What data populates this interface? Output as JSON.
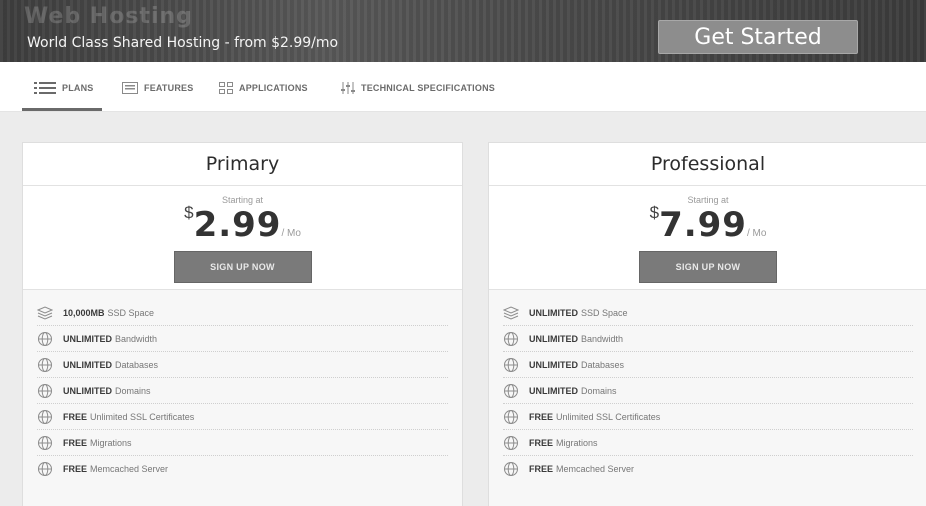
{
  "hero": {
    "title": "Web Hosting",
    "subtitle": "World Class Shared Hosting - from $2.99/mo",
    "cta_label": "Get Started"
  },
  "tabs": [
    {
      "label": "PLANS",
      "icon": "list-icon",
      "active": true
    },
    {
      "label": "FEATURES",
      "icon": "features-icon",
      "active": false
    },
    {
      "label": "APPLICATIONS",
      "icon": "grid-icon",
      "active": false
    },
    {
      "label": "TECHNICAL SPECIFICATIONS",
      "icon": "sliders-icon",
      "active": false
    }
  ],
  "plans": [
    {
      "name": "Primary",
      "starting_label": "Starting at",
      "currency": "$",
      "price": "2.99",
      "period": "/ Mo",
      "button_label": "SIGN UP NOW",
      "features": [
        {
          "strong": "10,000MB",
          "rest": "SSD Space",
          "icon": "storage-icon"
        },
        {
          "strong": "UNLIMITED",
          "rest": "Bandwidth",
          "icon": "globe-icon"
        },
        {
          "strong": "UNLIMITED",
          "rest": "Databases",
          "icon": "globe-icon"
        },
        {
          "strong": "UNLIMITED",
          "rest": "Domains",
          "icon": "globe-icon"
        },
        {
          "strong": "FREE",
          "rest": "Unlimited SSL Certificates",
          "icon": "globe-icon"
        },
        {
          "strong": "FREE",
          "rest": "Migrations",
          "icon": "globe-icon"
        },
        {
          "strong": "FREE",
          "rest": "Memcached Server",
          "icon": "globe-icon"
        }
      ]
    },
    {
      "name": "Professional",
      "starting_label": "Starting at",
      "currency": "$",
      "price": "7.99",
      "period": "/ Mo",
      "button_label": "SIGN UP NOW",
      "features": [
        {
          "strong": "UNLIMITED",
          "rest": "SSD Space",
          "icon": "storage-icon"
        },
        {
          "strong": "UNLIMITED",
          "rest": "Bandwidth",
          "icon": "globe-icon"
        },
        {
          "strong": "UNLIMITED",
          "rest": "Databases",
          "icon": "globe-icon"
        },
        {
          "strong": "UNLIMITED",
          "rest": "Domains",
          "icon": "globe-icon"
        },
        {
          "strong": "FREE",
          "rest": "Unlimited SSL Certificates",
          "icon": "globe-icon"
        },
        {
          "strong": "FREE",
          "rest": "Migrations",
          "icon": "globe-icon"
        },
        {
          "strong": "FREE",
          "rest": "Memcached Server",
          "icon": "globe-icon"
        }
      ]
    }
  ],
  "colors": {
    "banner": "#4a4a4a",
    "cta": "#8d8d8d",
    "signup": "#7a7a7a",
    "page_bg": "#ececec"
  }
}
